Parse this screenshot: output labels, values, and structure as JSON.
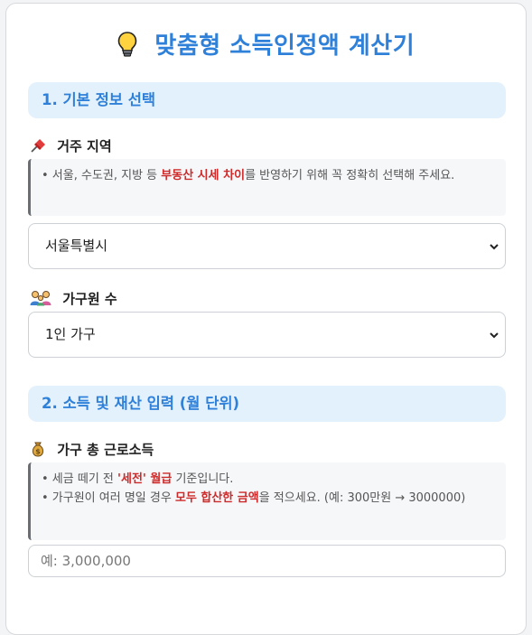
{
  "title": "맞춤형 소득인정액 계산기",
  "sections": [
    {
      "label": "1. 기본 정보 선택"
    },
    {
      "label": "2. 소득 및 재산 입력 (월 단위)"
    }
  ],
  "region": {
    "label": "거주 지역",
    "icon": "pushpin-icon",
    "hint": {
      "prefix": "• 서울, 수도권, 지방 등 ",
      "highlight": "부동산 시세 차이",
      "suffix": "를 반영하기 위해 꼭 정확히 선택해 주세요."
    },
    "selected": "서울특별시"
  },
  "household": {
    "label": "가구원 수",
    "icon": "family-icon",
    "selected": "1인 가구"
  },
  "income": {
    "label": "가구 총 근로소득",
    "icon": "money-bag-icon",
    "hint1": {
      "prefix": "• 세금 떼기 전 ",
      "highlight": "'세전' 월급",
      "suffix": " 기준입니다."
    },
    "hint2": {
      "prefix": "• 가구원이 여러 명일 경우 ",
      "highlight": "모두 합산한 금액",
      "suffix": "을 적으세요. (예: 300만원 → 3000000)"
    },
    "placeholder": "예: 3,000,000"
  },
  "colors": {
    "accent": "#2f80d8",
    "section_bg": "#e3f1fd",
    "highlight": "#cf2a2a"
  }
}
